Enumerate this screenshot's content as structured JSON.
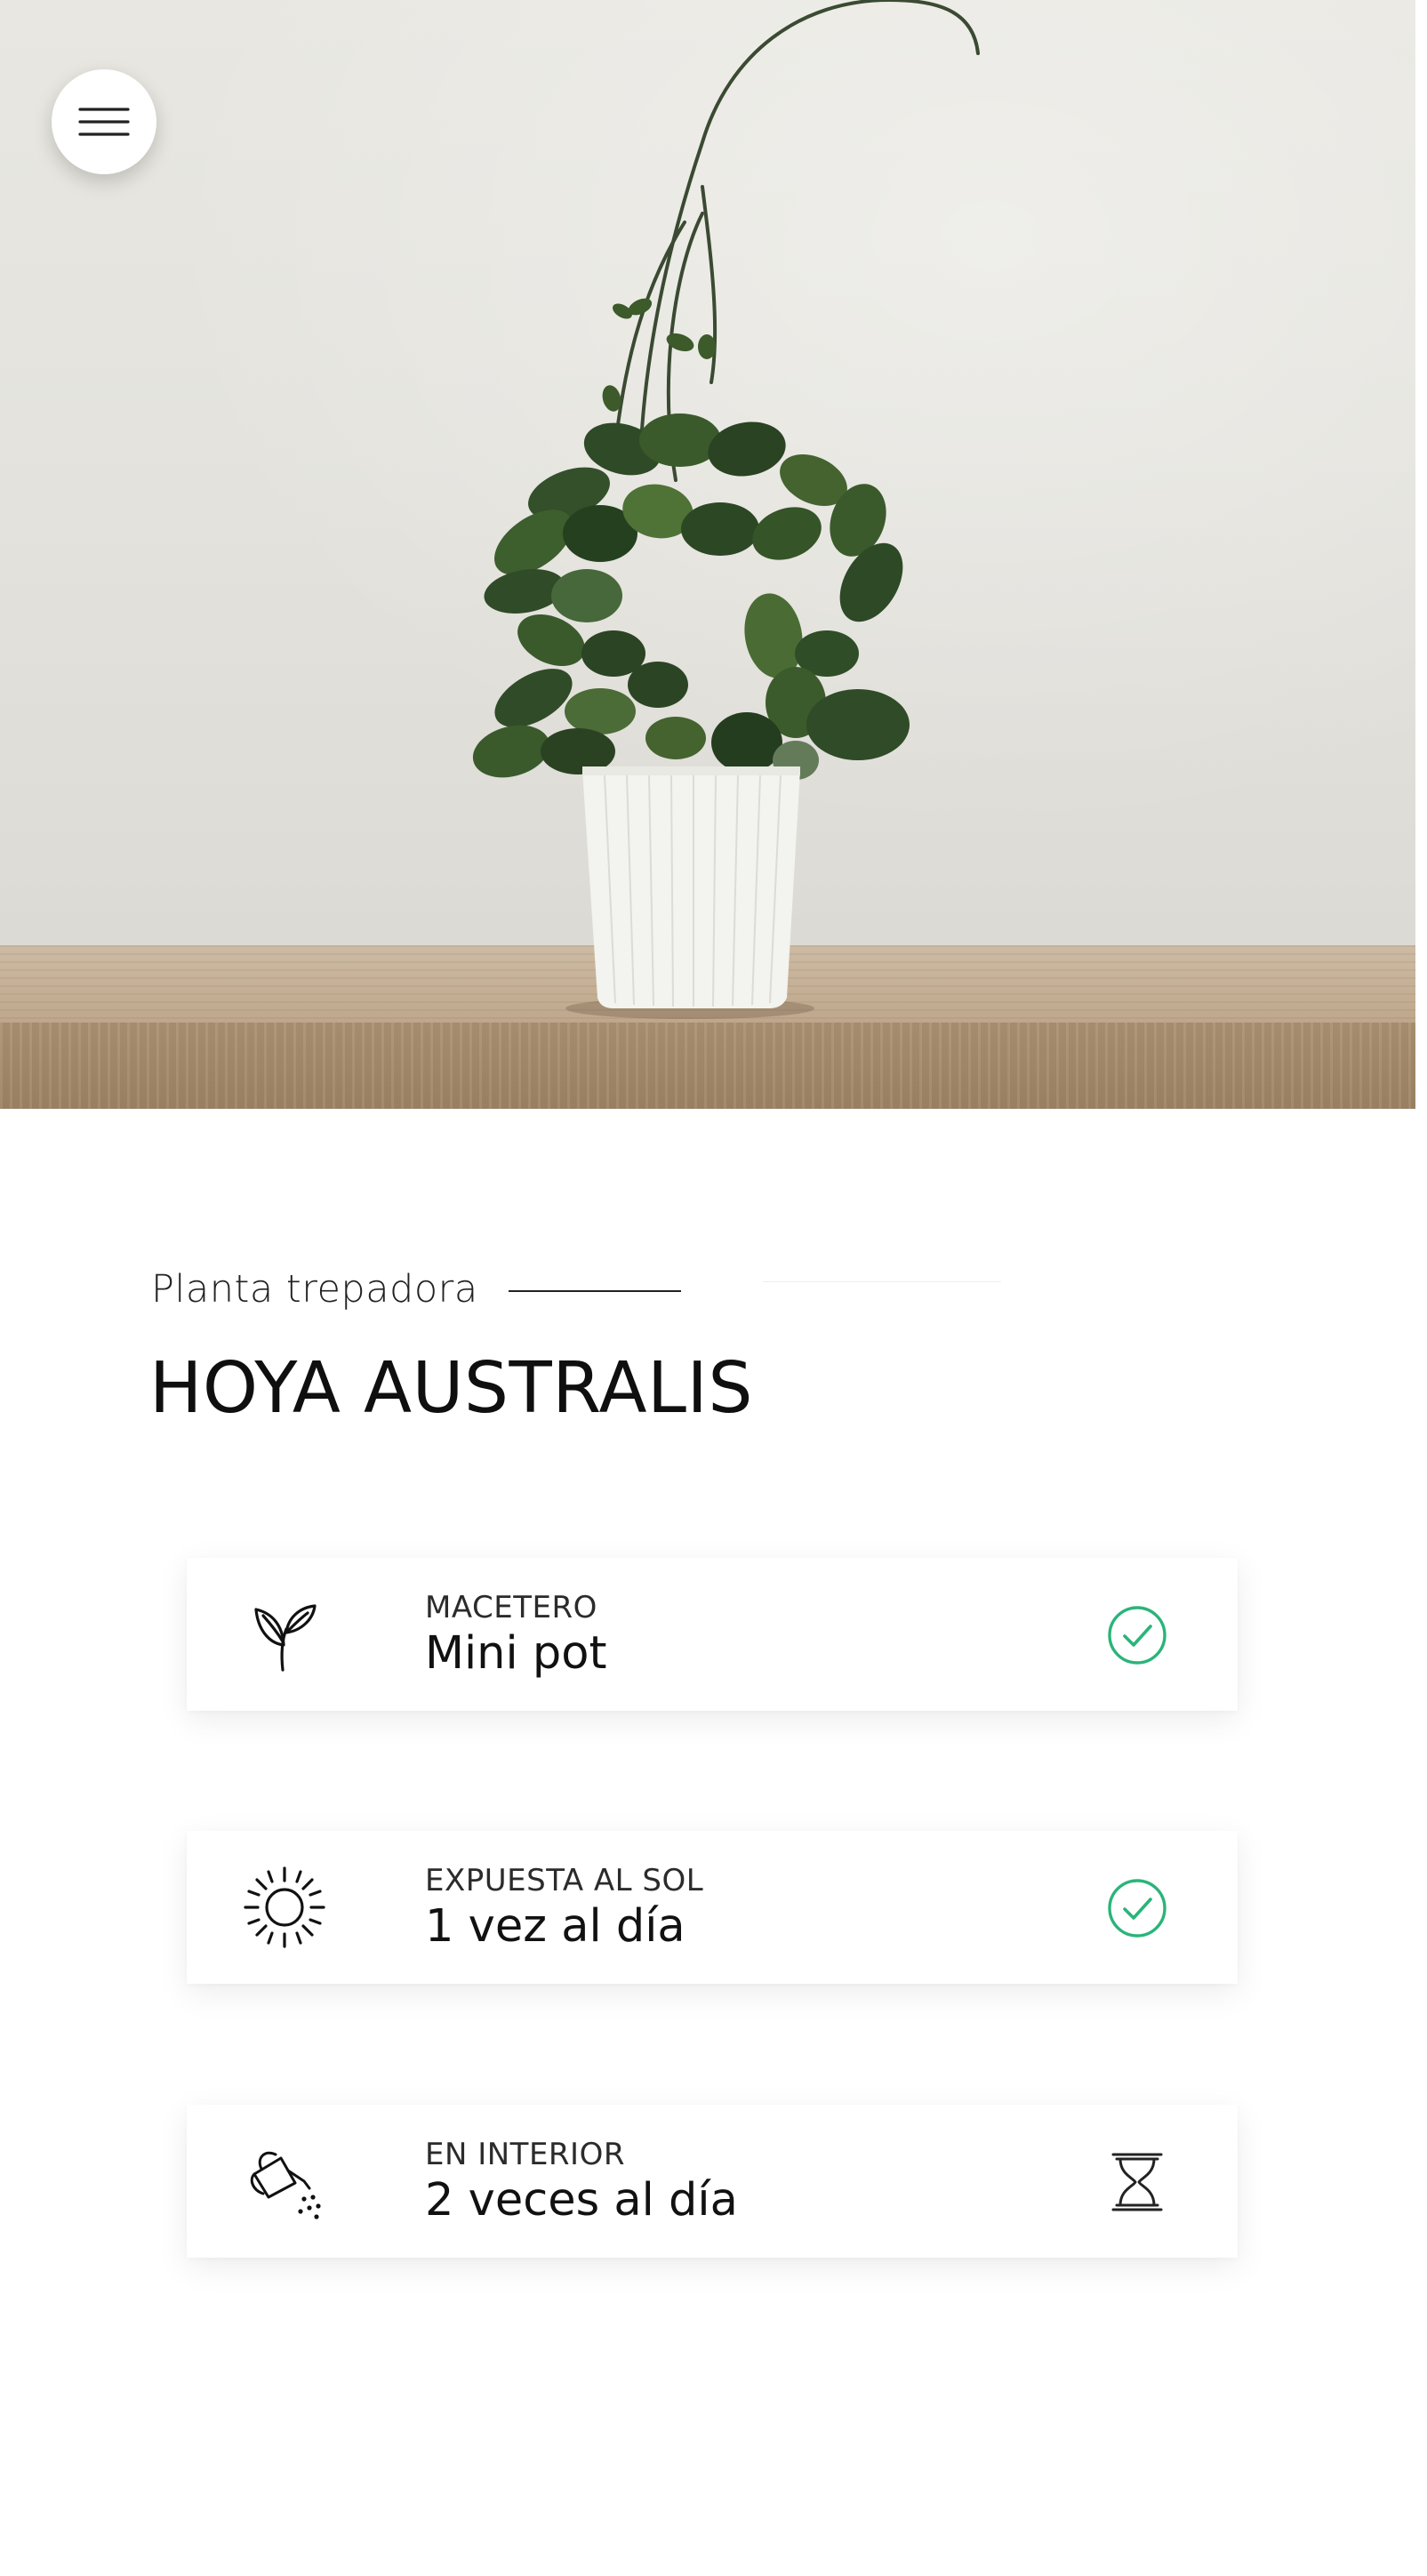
{
  "hero": {
    "image": "potted hoya plant on wooden shelf",
    "menu_icon": "hamburger-menu-icon"
  },
  "plant": {
    "category": "Planta trepadora",
    "name": "HOYA AUSTRALIS"
  },
  "colors": {
    "accent_green": "#2bb47a",
    "text": "#111111"
  },
  "care": [
    {
      "label": "MACETERO",
      "value": "Mini pot",
      "icon": "sprout-icon",
      "status": "check-circle-icon"
    },
    {
      "label": "EXPUESTA AL SOL",
      "value": "1 vez al día",
      "icon": "sun-icon",
      "status": "check-circle-icon"
    },
    {
      "label": "EN INTERIOR",
      "value": "2 veces al día",
      "icon": "watering-can-icon",
      "status": "hourglass-icon"
    }
  ]
}
